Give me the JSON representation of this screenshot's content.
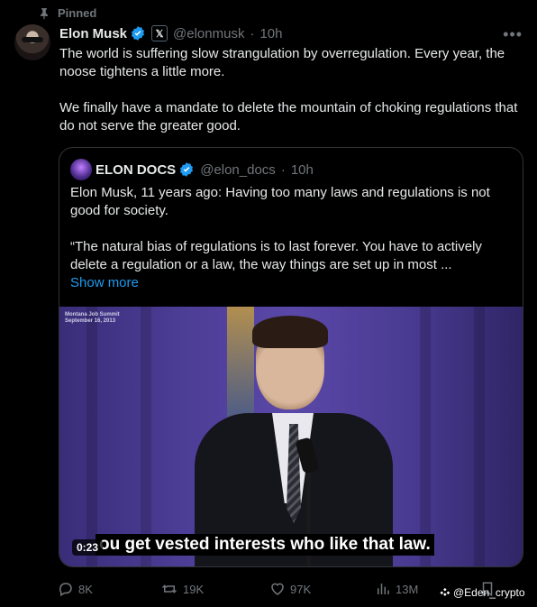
{
  "pinned_label": "Pinned",
  "post": {
    "author_name": "Elon Musk",
    "affiliate_badge": "𝕏",
    "handle": "@elonmusk",
    "time": "10h",
    "text_p1": "The world is suffering slow strangulation by overregulation. Every year, the noose tightens a little more.",
    "text_p2": "We finally have a mandate to delete the mountain of choking regulations that do not serve the greater good."
  },
  "quote": {
    "author_name": "ELON DOCS",
    "handle": "@elon_docs",
    "time": "10h",
    "text_p1": "Elon Musk, 11 years ago: Having too many laws and regulations is not good for society.",
    "text_p2": "“The natural bias of regulations is to last forever. You have to actively delete a regulation or a law, the way things are set up in most ...",
    "show_more": "Show more",
    "video": {
      "overlay_line1": "Montana Job Summit",
      "overlay_line2": "September 16, 2013",
      "subtitle": "ou get vested interests who like that law.",
      "timestamp": "0:23"
    }
  },
  "actions": {
    "replies": "8K",
    "reposts": "19K",
    "likes": "97K",
    "views": "13M"
  },
  "watermark": "@Eden_crypto",
  "colors": {
    "background": "#000000",
    "text": "#e7e9ea",
    "muted": "#71767b",
    "link": "#1d9bf0",
    "verified": "#1d9bf0"
  }
}
